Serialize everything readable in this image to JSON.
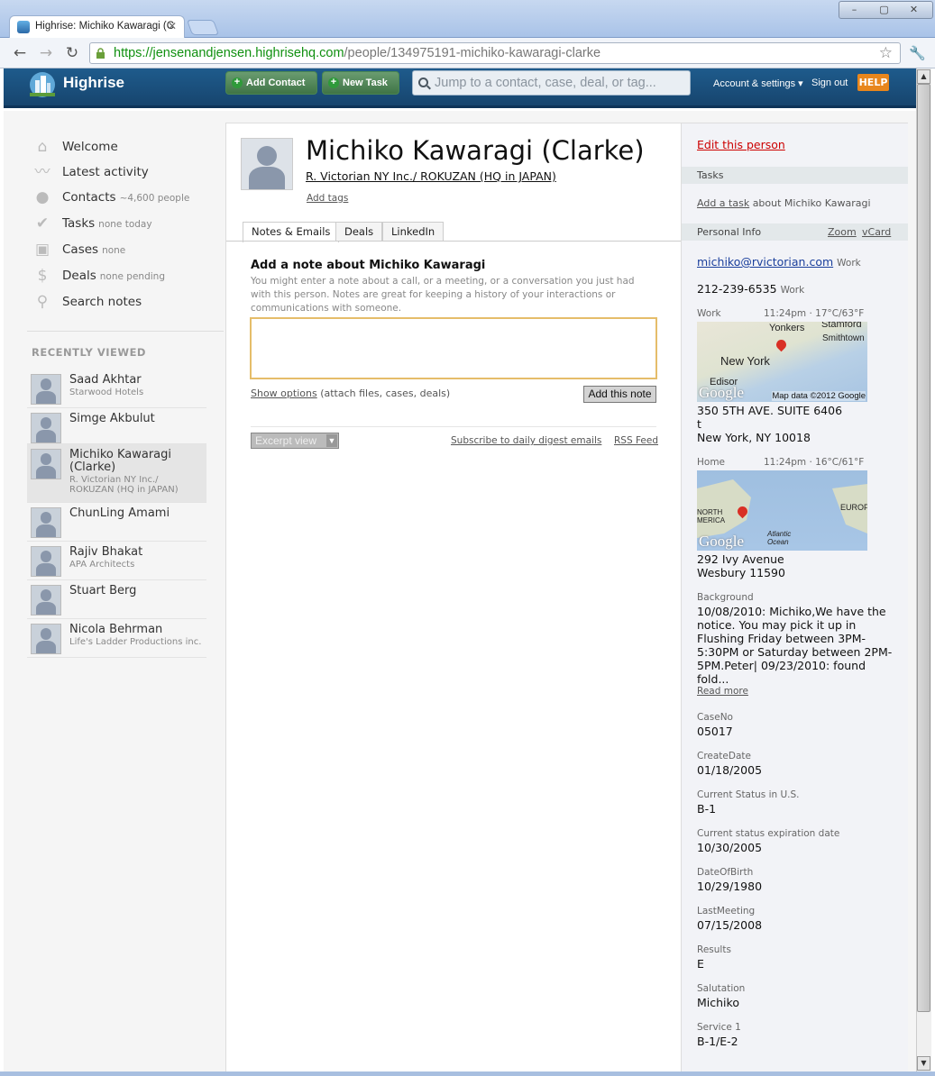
{
  "browser": {
    "tab_title": "Highrise: Michiko Kawaragi (C",
    "url_secure": "https://jensenandjensen.highrisehq.com",
    "url_path": "/people/134975191-michiko-kawaragi-clarke",
    "window_controls": [
      "–",
      "▢",
      "✕"
    ]
  },
  "header": {
    "logo": "Highrise",
    "add_contact": "Add Contact",
    "new_task": "New Task",
    "search_placeholder": "Jump to a contact, case, deal, or tag...",
    "account": "Account & settings ▾",
    "sign_out": "Sign out",
    "help": "HELP"
  },
  "sidebar": {
    "nav": [
      {
        "label": "Welcome",
        "meta": "",
        "icon": "home-icon"
      },
      {
        "label": "Latest activity",
        "meta": "",
        "icon": "activity-icon"
      },
      {
        "label": "Contacts",
        "meta": "~4,600 people",
        "icon": "person-icon"
      },
      {
        "label": "Tasks",
        "meta": "none today",
        "icon": "check-icon"
      },
      {
        "label": "Cases",
        "meta": "none",
        "icon": "briefcase-icon"
      },
      {
        "label": "Deals",
        "meta": "none pending",
        "icon": "dollar-icon"
      },
      {
        "label": "Search notes",
        "meta": "",
        "icon": "search-icon"
      }
    ],
    "recent_heading": "RECENTLY VIEWED",
    "recent": [
      {
        "name": "Saad Akhtar",
        "sub": "Starwood Hotels"
      },
      {
        "name": "Simge Akbulut",
        "sub": ""
      },
      {
        "name": "Michiko Kawaragi (Clarke)",
        "sub": "R. Victorian NY Inc./ ROKUZAN (HQ in JAPAN)"
      },
      {
        "name": "ChunLing Amami",
        "sub": ""
      },
      {
        "name": "Rajiv Bhakat",
        "sub": "APA Architects"
      },
      {
        "name": "Stuart Berg",
        "sub": ""
      },
      {
        "name": "Nicola Behrman",
        "sub": "Life's Ladder Productions inc."
      }
    ]
  },
  "person": {
    "name": "Michiko Kawaragi (Clarke)",
    "company": "R. Victorian NY Inc./ ROKUZAN (HQ in JAPAN)",
    "add_tags": "Add tags"
  },
  "tabs": [
    "Notes & Emails",
    "Deals",
    "LinkedIn"
  ],
  "note": {
    "title": "Add a note about Michiko Kawaragi",
    "help": "You might enter a note about a call, or a meeting, or a conversation you just had with this person. Notes are great for keeping a history of your interactions or communications with someone.",
    "show_options": "Show options",
    "show_options_hint": "(attach files, cases, deals)",
    "add_button": "Add this note",
    "excerpt_view": "Excerpt view",
    "subscribe": "Subscribe to daily digest emails",
    "rss": "RSS Feed"
  },
  "right": {
    "edit": "Edit this person",
    "tasks_heading": "Tasks",
    "add_task": "Add a task",
    "add_task_suffix": "about Michiko Kawaragi",
    "personal_info": "Personal Info",
    "zoom": "Zoom",
    "vcard": "vCard",
    "email": "michiko@rvictorian.com",
    "email_kind": "Work",
    "phone": "212-239-6535",
    "phone_kind": "Work",
    "work_label": "Work",
    "work_time": "11:24pm · 17°C/63°F",
    "work_map": {
      "yonkers": "Yonkers",
      "stamford": "Stamford",
      "smithtown": "Smithtown",
      "newyork": "New York",
      "edison": "Edisor",
      "mapdata": "Map data ©2012 Google",
      "google": "Google"
    },
    "work_address": "350 5TH AVE. SUITE 6406\nt\nNew York, NY 10018",
    "home_label": "Home",
    "home_time": "11:24pm · 16°C/61°F",
    "home_map": {
      "north": "NORTH\nMERICA",
      "europe": "EUROP",
      "atlantic": "Atlantic\nOcean",
      "google": "Google"
    },
    "home_address": "292 Ivy Avenue\nWesbury 11590",
    "background_label": "Background",
    "background": "10/08/2010: Michiko,We have the notice. You may pick it up in Flushing Friday between 3PM-5:30PM or Saturday between 2PM-5PM.Peter| 09/23/2010: found fold...",
    "read_more": "Read more",
    "fields": [
      {
        "label": "CaseNo",
        "value": "05017"
      },
      {
        "label": "CreateDate",
        "value": "01/18/2005"
      },
      {
        "label": "Current Status in U.S.",
        "value": "B-1"
      },
      {
        "label": "Current status expiration date",
        "value": "10/30/2005"
      },
      {
        "label": "DateOfBirth",
        "value": "10/29/1980"
      },
      {
        "label": "LastMeeting",
        "value": "07/15/2008"
      },
      {
        "label": "Results",
        "value": "E"
      },
      {
        "label": "Salutation",
        "value": "Michiko"
      },
      {
        "label": "Service 1",
        "value": "B-1/E-2"
      }
    ]
  }
}
